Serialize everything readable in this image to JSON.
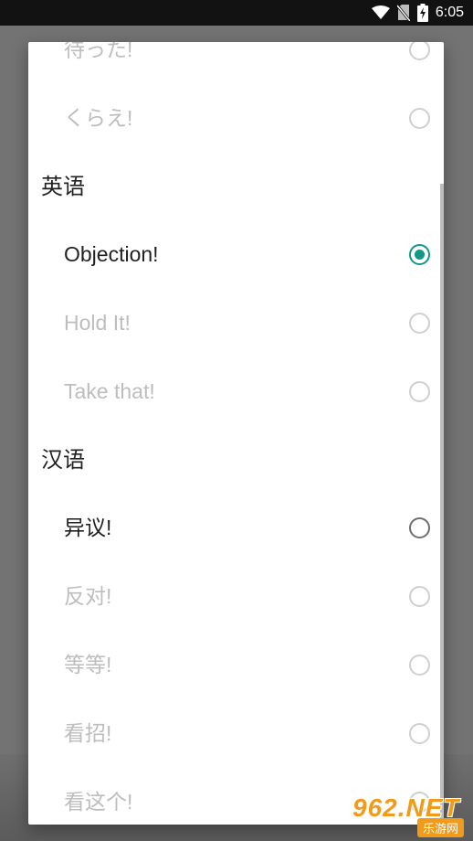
{
  "status_bar": {
    "time": "6:05",
    "icons": [
      "wifi-icon",
      "no-sim-icon",
      "battery-charging-icon"
    ]
  },
  "dialog": {
    "items": [
      {
        "kind": "option",
        "label": "待った!",
        "enabled": false,
        "checked": false
      },
      {
        "kind": "option",
        "label": "くらえ!",
        "enabled": false,
        "checked": false
      },
      {
        "kind": "header",
        "label": "英语"
      },
      {
        "kind": "option",
        "label": "Objection!",
        "enabled": true,
        "checked": true
      },
      {
        "kind": "option",
        "label": "Hold It!",
        "enabled": false,
        "checked": false
      },
      {
        "kind": "option",
        "label": "Take that!",
        "enabled": false,
        "checked": false
      },
      {
        "kind": "header",
        "label": "汉语"
      },
      {
        "kind": "option",
        "label": "异议!",
        "enabled": true,
        "checked": false
      },
      {
        "kind": "option",
        "label": "反对!",
        "enabled": false,
        "checked": false
      },
      {
        "kind": "option",
        "label": "等等!",
        "enabled": false,
        "checked": false
      },
      {
        "kind": "option",
        "label": "看招!",
        "enabled": false,
        "checked": false
      },
      {
        "kind": "option",
        "label": "看这个!",
        "enabled": false,
        "checked": false
      }
    ]
  },
  "colors": {
    "accent": "#139789",
    "enabled_text": "#212121",
    "disabled_text": "#bdbdbd"
  },
  "watermark": {
    "top": "962.NET",
    "bottom": "乐游网"
  }
}
